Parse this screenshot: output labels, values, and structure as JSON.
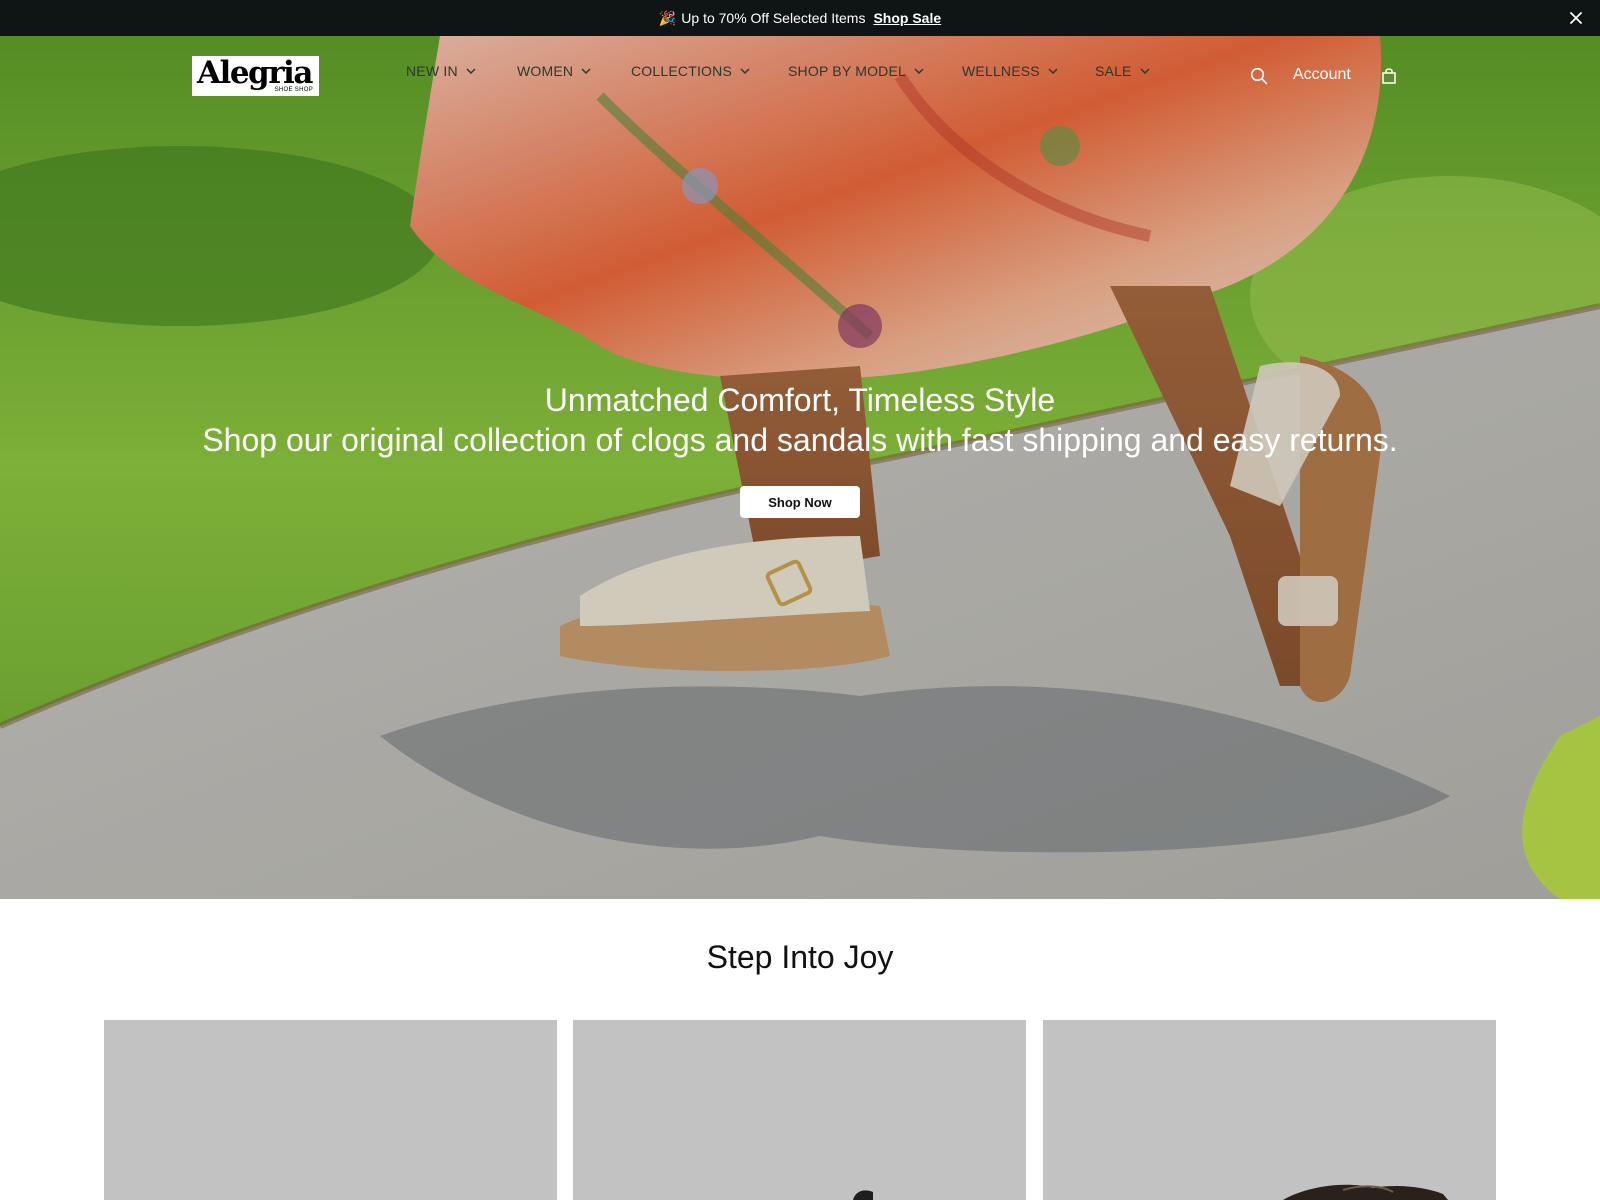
{
  "announcement": {
    "icon": "party-popper-icon",
    "message": "Up to 70% Off Selected Items",
    "link_label": "Shop Sale"
  },
  "header": {
    "logo_text": "Alegria",
    "logo_subtext": "SHOE SHOP",
    "nav": [
      {
        "label": "NEW IN"
      },
      {
        "label": "WOMEN"
      },
      {
        "label": "COLLECTIONS"
      },
      {
        "label": "SHOP BY MODEL"
      },
      {
        "label": "WELLNESS"
      },
      {
        "label": "SALE"
      }
    ],
    "account_label": "Account",
    "search_icon": "search-icon",
    "cart_icon": "shopping-bag-icon"
  },
  "hero": {
    "title": "Unmatched Comfort, Timeless Style",
    "subtitle": "Shop our original collection of clogs and sandals with fast shipping and easy returns.",
    "cta_label": "Shop Now"
  },
  "section": {
    "title": "Step Into Joy",
    "cards": [
      {
        "name": "product-card-1"
      },
      {
        "name": "product-card-2"
      },
      {
        "name": "product-card-3"
      }
    ]
  }
}
